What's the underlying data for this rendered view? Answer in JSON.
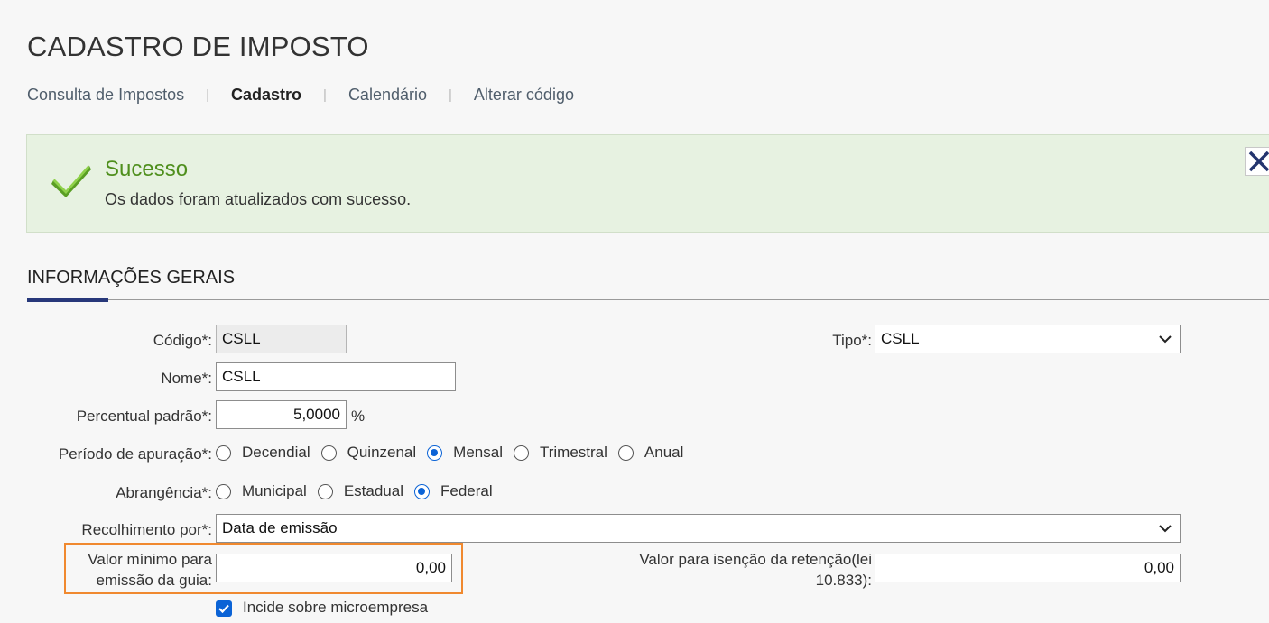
{
  "page": {
    "title": "CADASTRO DE IMPOSTO"
  },
  "subnav": {
    "items": [
      "Consulta de Impostos",
      "Cadastro",
      "Calendário",
      "Alterar código"
    ],
    "active": "Cadastro"
  },
  "alert": {
    "title": "Sucesso",
    "message": "Os dados foram atualizados com sucesso.",
    "status_color": "#4f8f1d",
    "icon": "checkmark-icon"
  },
  "section": {
    "title": "INFORMAÇÕES GERAIS",
    "accent_color": "#27387a"
  },
  "form": {
    "codigo": {
      "label": "Código*:",
      "value": "CSLL"
    },
    "tipo": {
      "label": "Tipo*:",
      "value": "CSLL"
    },
    "nome": {
      "label": "Nome*:",
      "value": "CSLL"
    },
    "percentual": {
      "label": "Percentual padrão*:",
      "value": "5,0000",
      "unit": "%"
    },
    "periodo": {
      "label": "Período de apuração*:",
      "options": [
        "Decendial",
        "Quinzenal",
        "Mensal",
        "Trimestral",
        "Anual"
      ],
      "selected": "Mensal"
    },
    "abrangencia": {
      "label": "Abrangência*:",
      "options": [
        "Municipal",
        "Estadual",
        "Federal"
      ],
      "selected": "Federal"
    },
    "recolhimento": {
      "label": "Recolhimento por*:",
      "value": "Data de emissão"
    },
    "valor_minimo": {
      "label_line1": "Valor mínimo para",
      "label_line2": "emissão da guia:",
      "value": "0,00"
    },
    "valor_isencao": {
      "label_line1": "Valor para isenção da retenção(lei",
      "label_line2": "10.833):",
      "value": "0,00"
    },
    "microempresa": {
      "label": "Incide sobre microempresa",
      "checked": true
    }
  },
  "colors": {
    "highlight": "#f0892f",
    "radio_selected": "#0b63d6"
  }
}
